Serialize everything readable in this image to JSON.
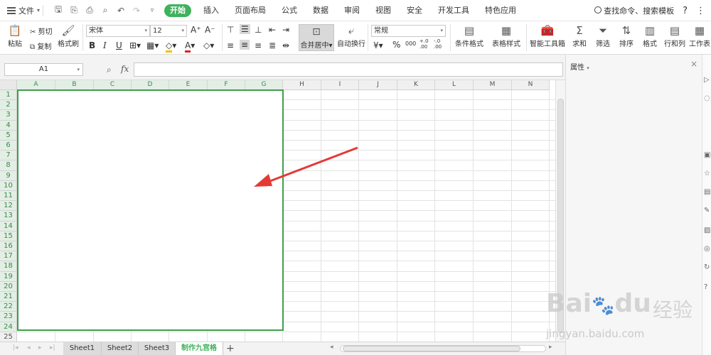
{
  "menubar": {
    "file_label": "文件",
    "tabs": [
      "开始",
      "插入",
      "页面布局",
      "公式",
      "数据",
      "审阅",
      "视图",
      "安全",
      "开发工具",
      "特色应用"
    ],
    "active_tab": "开始",
    "search_label": "查找命令、搜索模板",
    "help": "?",
    "more": "⋮"
  },
  "ribbon": {
    "paste": "粘贴",
    "cut": "剪切",
    "copy": "复制",
    "format_painter": "格式刷",
    "font_name": "宋体",
    "font_size": "12",
    "grow_font": "A⁺",
    "shrink_font": "A⁻",
    "bold": "B",
    "italic": "I",
    "underline": "U",
    "merge_center": "合并居中",
    "wrap_text": "自动换行",
    "number_format": "常规",
    "percent": "%",
    "thousands": "000",
    "inc_decimal": "+.0 .00",
    "dec_decimal": "-.0 .00",
    "conditional_format": "条件格式",
    "table_style": "表格样式",
    "smart_toolbox": "智能工具箱",
    "sum": "求和",
    "filter": "筛选",
    "sort": "排序",
    "format": "格式",
    "row_col": "行和列",
    "worksheet": "工作表"
  },
  "formula_bar": {
    "cell_ref": "A1",
    "fx": "fx",
    "content": ""
  },
  "grid": {
    "columns": [
      "A",
      "B",
      "C",
      "D",
      "E",
      "F",
      "G",
      "H",
      "I",
      "J",
      "K",
      "L",
      "M",
      "N"
    ],
    "rows": [
      "1",
      "2",
      "3",
      "4",
      "5",
      "6",
      "7",
      "8",
      "9",
      "10",
      "11",
      "12",
      "13",
      "14",
      "15",
      "16",
      "17",
      "18",
      "19",
      "20",
      "21",
      "22",
      "23",
      "24",
      "25"
    ],
    "selected_range": "A1:G24"
  },
  "sheets": {
    "tabs": [
      "Sheet1",
      "Sheet2",
      "Sheet3",
      "制作九宫格"
    ],
    "active": "制作九宫格",
    "add": "+"
  },
  "side_panel": {
    "title": "属性",
    "close": "×"
  },
  "watermark": {
    "brand": "Bai",
    "brand_suffix": "du",
    "cn": "经验",
    "url": "jingyan.baidu.com"
  },
  "colors": {
    "accent": "#3fb25c",
    "selection_border": "#3f9e4d",
    "arrow": "#e53935"
  }
}
